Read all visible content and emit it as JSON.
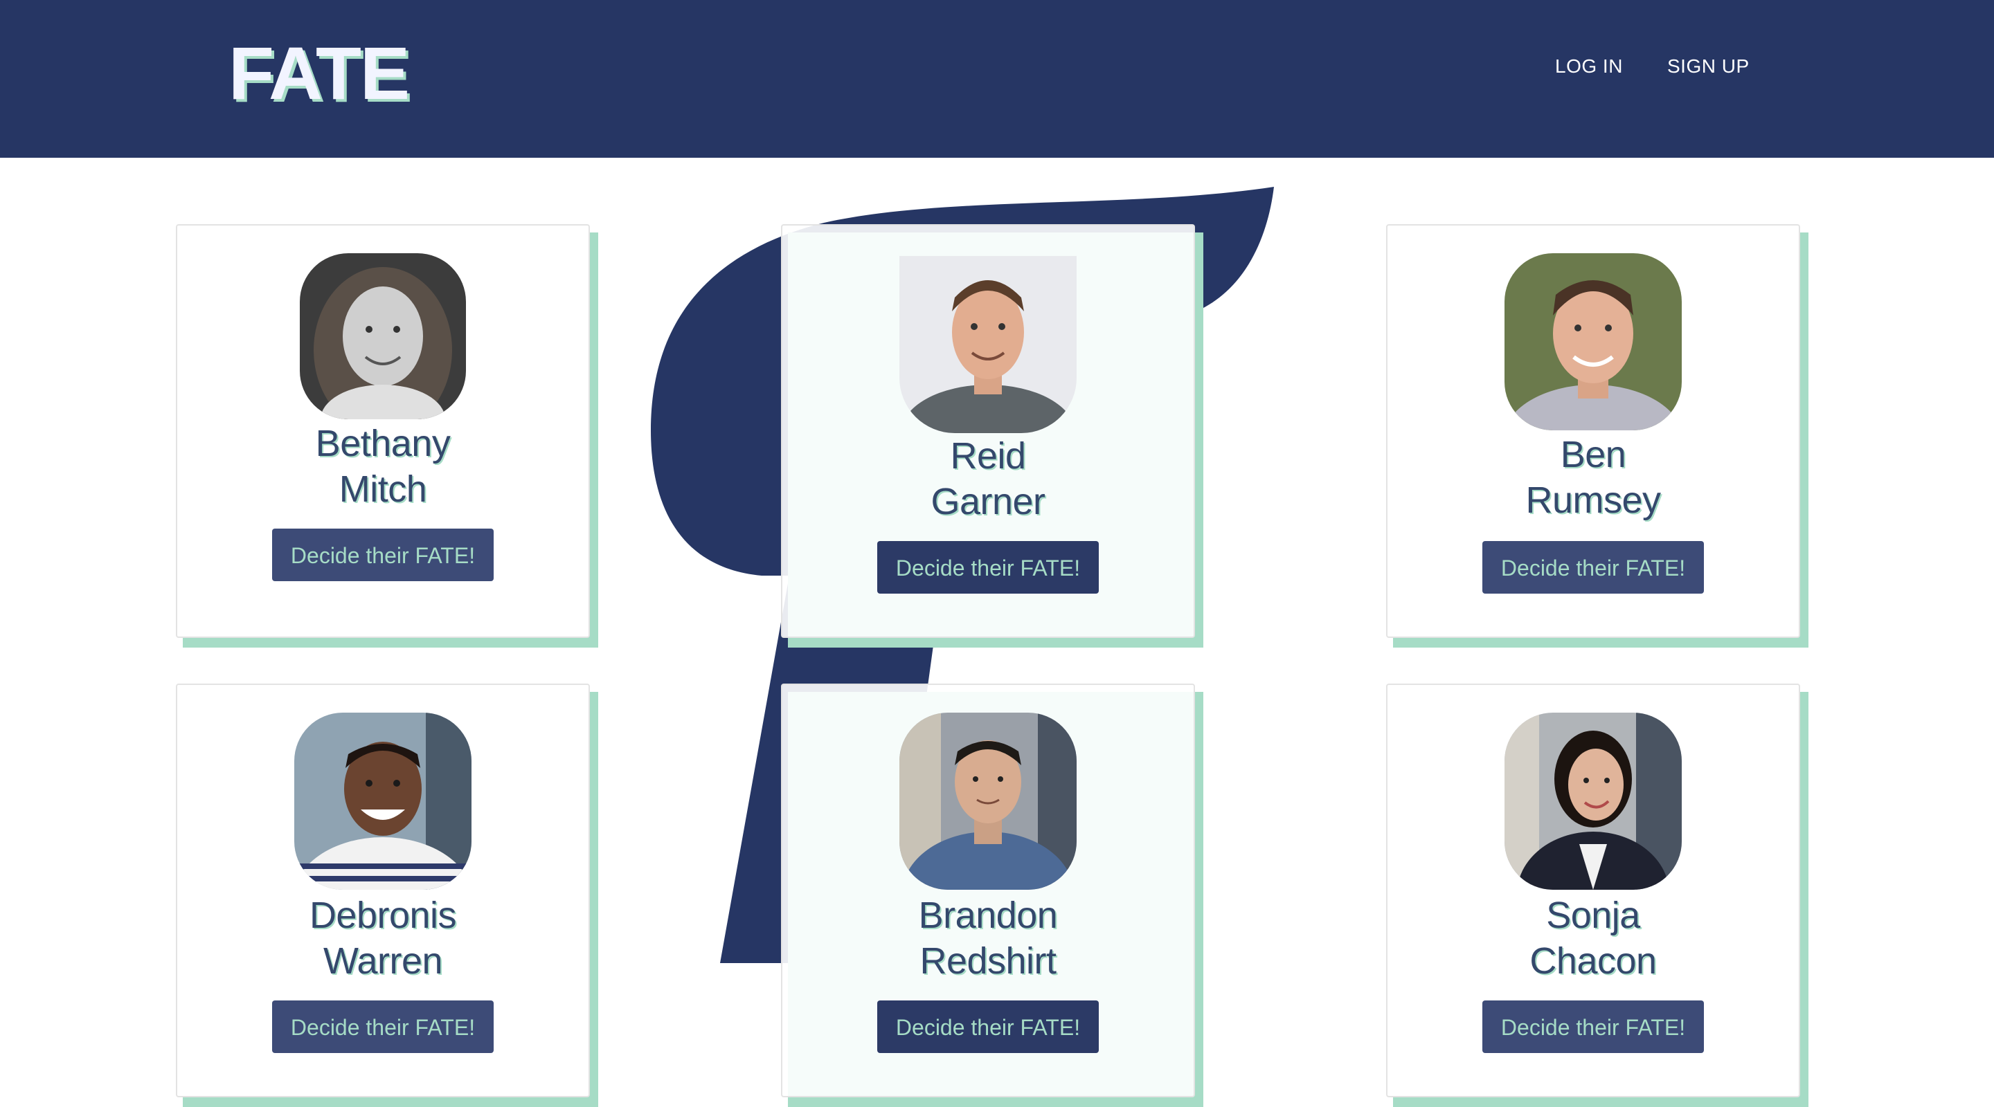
{
  "brand": {
    "logo_text": "FATE"
  },
  "nav": {
    "login_label": "LOG IN",
    "signup_label": "SIGN UP"
  },
  "colors": {
    "navbar": "#263664",
    "accent_mint": "#a6dcc6",
    "button": "#3d4b77",
    "name_text": "#34486c"
  },
  "people": [
    {
      "first": "Bethany",
      "last": "Mitch",
      "button_label": "Decide their FATE!",
      "photo": "grayscale portrait of smiling woman with long hair"
    },
    {
      "first": "Reid",
      "last": "Garner",
      "button_label": "Decide their FATE!",
      "photo": "portrait of smiling man in grey shirt"
    },
    {
      "first": "Ben",
      "last": "Rumsey",
      "button_label": "Decide their FATE!",
      "photo": "portrait of smiling young man outdoors"
    },
    {
      "first": "Debronis",
      "last": "Warren",
      "button_label": "Decide their FATE!",
      "photo": "portrait of smiling man in striped polo"
    },
    {
      "first": "Brandon",
      "last": "Redshirt",
      "button_label": "Decide their FATE!",
      "photo": "portrait of man with crossed arms in blue shirt"
    },
    {
      "first": "Sonja",
      "last": "Chacon",
      "button_label": "Decide their FATE!",
      "photo": "portrait of smiling woman in dark blazer"
    }
  ]
}
